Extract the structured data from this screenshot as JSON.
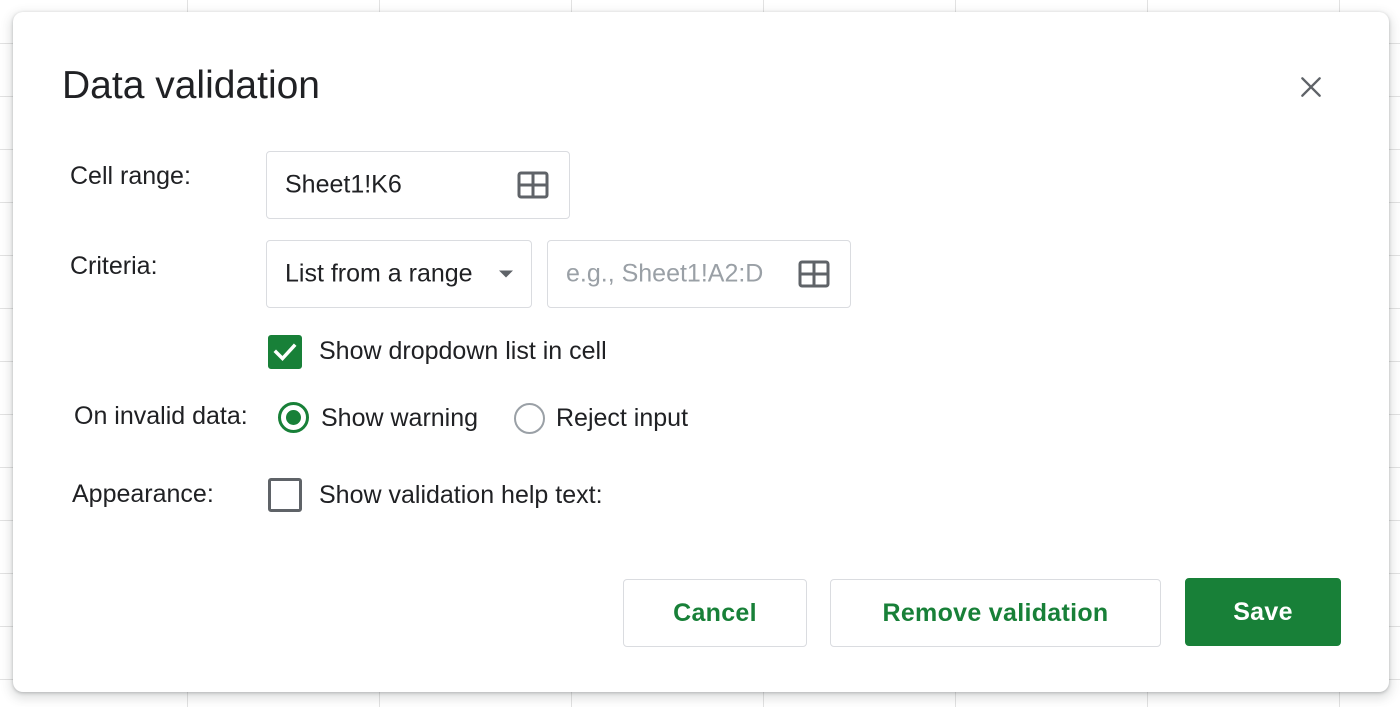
{
  "dialog": {
    "title": "Data validation",
    "close_icon": "close-icon"
  },
  "cell_range": {
    "label": "Cell range:",
    "value": "Sheet1!K6",
    "icon": "grid-select-icon"
  },
  "criteria": {
    "label": "Criteria:",
    "type_value": "List from a range",
    "range_placeholder": "e.g., Sheet1!A2:D",
    "range_value": "",
    "icon": "grid-select-icon"
  },
  "dropdown_option": {
    "label": "Show dropdown list in cell",
    "checked": true
  },
  "invalid_data": {
    "label": "On invalid data:",
    "options": [
      {
        "label": "Show warning",
        "selected": true
      },
      {
        "label": "Reject input",
        "selected": false
      }
    ]
  },
  "appearance": {
    "label": "Appearance:",
    "help_text_label": "Show validation help text:",
    "checked": false
  },
  "buttons": {
    "cancel": "Cancel",
    "remove": "Remove validation",
    "save": "Save"
  },
  "colors": {
    "accent": "#188038",
    "border": "#dadce0",
    "text": "#202124",
    "placeholder": "#9aa0a6"
  }
}
